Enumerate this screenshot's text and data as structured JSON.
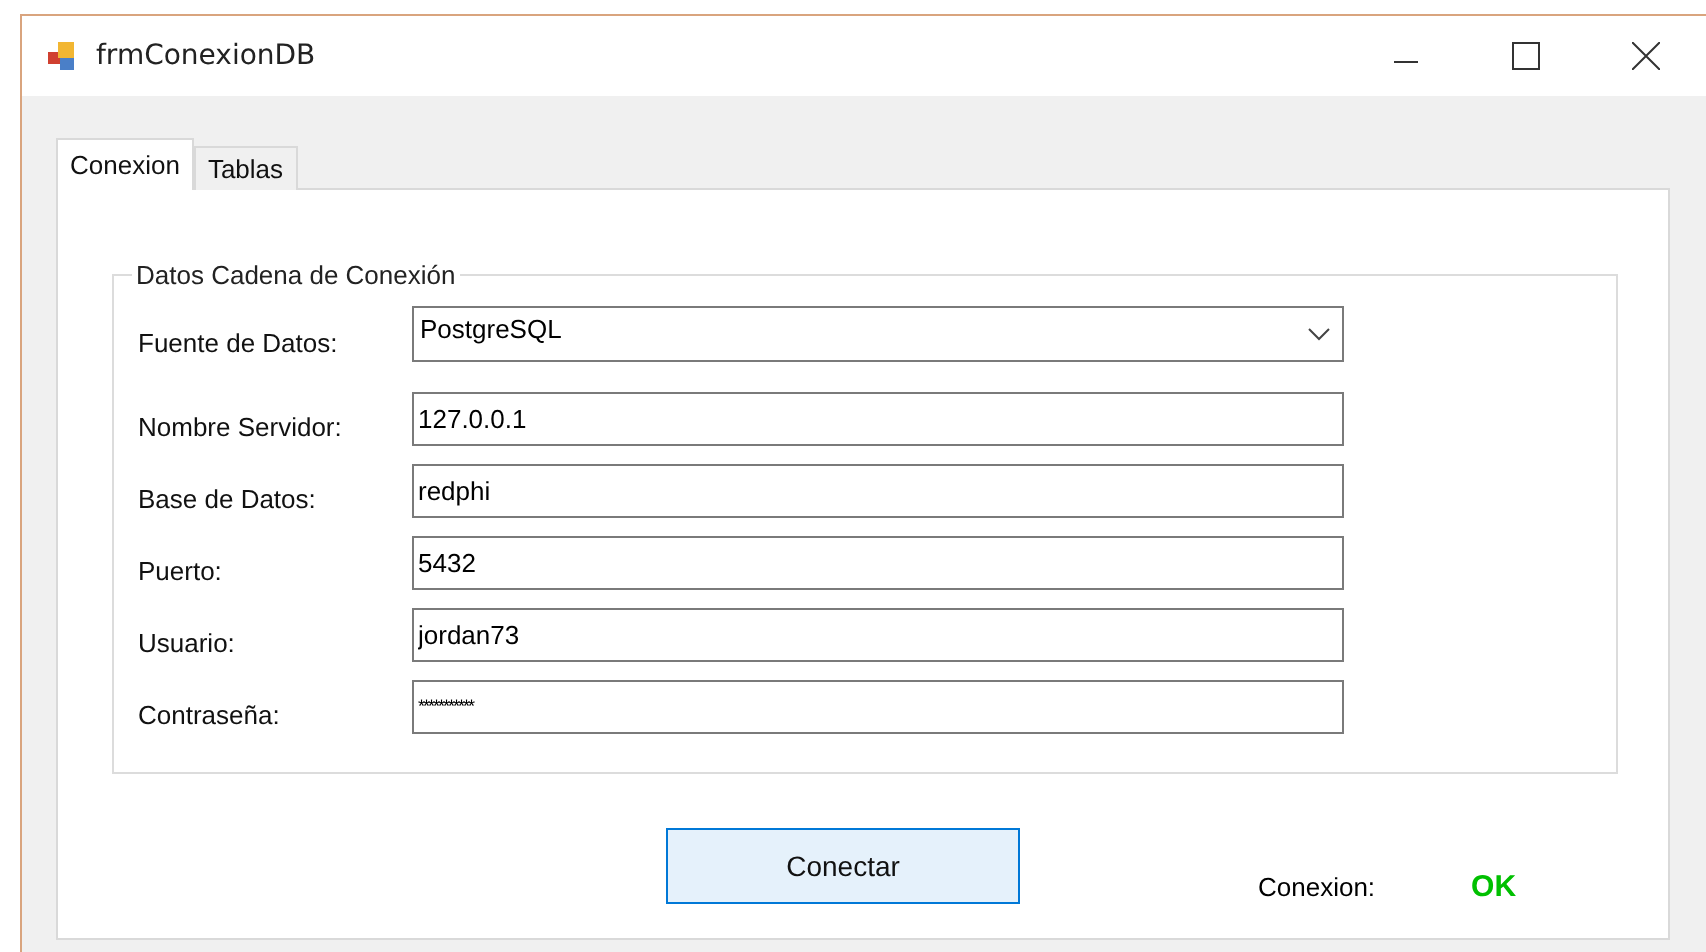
{
  "window": {
    "title": "frmConexionDB"
  },
  "tabs": [
    {
      "label": "Conexion",
      "selected": true
    },
    {
      "label": "Tablas",
      "selected": false
    }
  ],
  "group": {
    "title": "Datos Cadena de Conexión",
    "fields": [
      {
        "kind": "dropdown",
        "label": "Fuente de Datos:",
        "value": "PostgreSQL"
      },
      {
        "kind": "text",
        "label": "Nombre Servidor:",
        "value": "127.0.0.1"
      },
      {
        "kind": "text",
        "label": "Base de Datos:",
        "value": "redphi"
      },
      {
        "kind": "text",
        "label": "Puerto:",
        "value": "5432"
      },
      {
        "kind": "text",
        "label": "Usuario:",
        "value": "jordan73"
      },
      {
        "kind": "password",
        "label": "Contraseña:",
        "value": "***********"
      }
    ]
  },
  "connect_button": "Conectar",
  "status": {
    "label": "Conexion:",
    "value": "OK",
    "color": "#00c000"
  }
}
